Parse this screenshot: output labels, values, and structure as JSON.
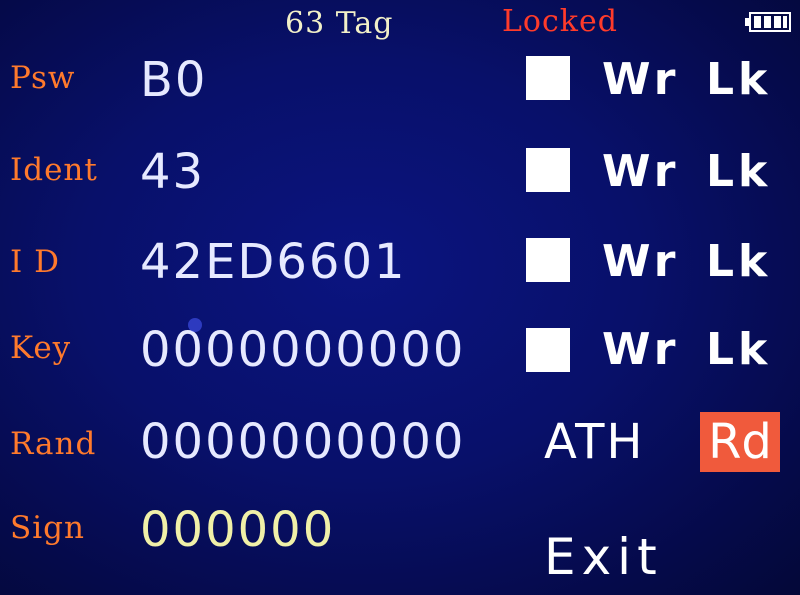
{
  "status_bar": {
    "tag_count": "63 Tag",
    "lock_status": "Locked",
    "battery_icon": "battery-full-icon"
  },
  "rows": [
    {
      "label": "Psw",
      "value": "B0",
      "write": "Wr",
      "lock": "Lk"
    },
    {
      "label": "Ident",
      "value": "43",
      "write": "Wr",
      "lock": "Lk"
    },
    {
      "label": "I D",
      "value": "42ED6601",
      "write": "Wr",
      "lock": "Lk"
    },
    {
      "label": "Key",
      "value": "0000000000",
      "write": "Wr",
      "lock": "Lk"
    },
    {
      "label": "Rand",
      "value": "0000000000"
    },
    {
      "label": "Sign",
      "value": "000000"
    }
  ],
  "actions": {
    "ath_label": "ATH",
    "rd_label": "Rd",
    "exit_label": "Exit"
  },
  "colors": {
    "background": "#08106a",
    "label": "#ff7a2c",
    "value": "#e6e9ff",
    "sign_value": "#f0f0a8",
    "locked": "#ff3b2a",
    "rd_highlight": "#f05a3c"
  }
}
